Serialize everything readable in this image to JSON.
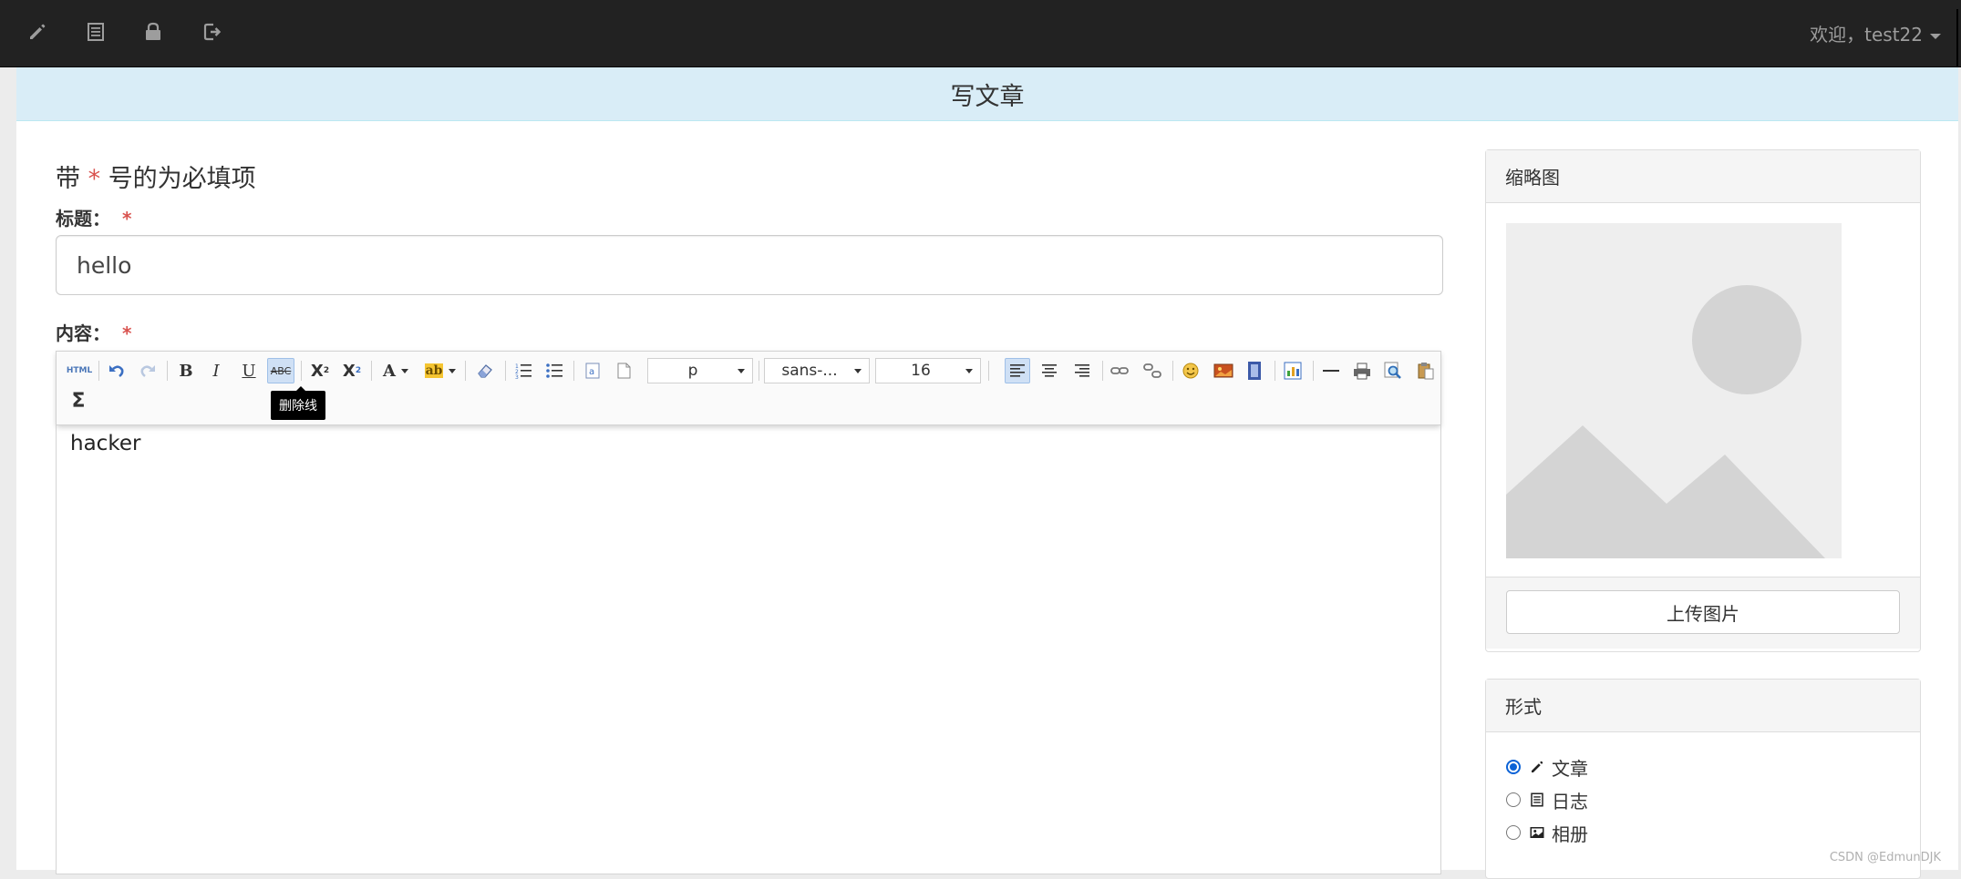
{
  "navbar": {
    "icons": [
      "pencil-icon",
      "list-icon",
      "lock-icon",
      "logout-icon"
    ],
    "welcome": "欢迎，test22"
  },
  "page": {
    "header_title": "写文章",
    "required_note_prefix": "带",
    "required_star": "*",
    "required_note_suffix": "号的为必填项"
  },
  "form": {
    "title_label": "标题：",
    "title_value": "hello",
    "content_label": "内容：",
    "content_text": "hacker"
  },
  "editor_toolbar": {
    "html_label": "HTML",
    "bold": "B",
    "italic": "I",
    "underline": "U",
    "strike": "ABC",
    "superscript": "X",
    "superscript_mark": "2",
    "subscript": "X",
    "subscript_mark": "2",
    "font_color": "A",
    "highlight": "ab",
    "paragraph_select": "p",
    "font_family_select": "sans-...",
    "font_size_select": "16",
    "formula": "Σ",
    "tooltip": "删除线"
  },
  "thumbnail_panel": {
    "heading": "缩略图",
    "upload_button": "上传图片"
  },
  "format_panel": {
    "heading": "形式",
    "options": [
      {
        "label": "文章",
        "icon": "pencil-icon",
        "checked": true
      },
      {
        "label": "日志",
        "icon": "list-icon",
        "checked": false
      },
      {
        "label": "相册",
        "icon": "picture-icon",
        "checked": false
      }
    ]
  },
  "watermark": "CSDN @EdmunDJK",
  "colors": {
    "navbar_bg": "#222222",
    "header_bg": "#d9edf7",
    "required": "#d9534f",
    "radio_accent": "#0b62d6"
  }
}
